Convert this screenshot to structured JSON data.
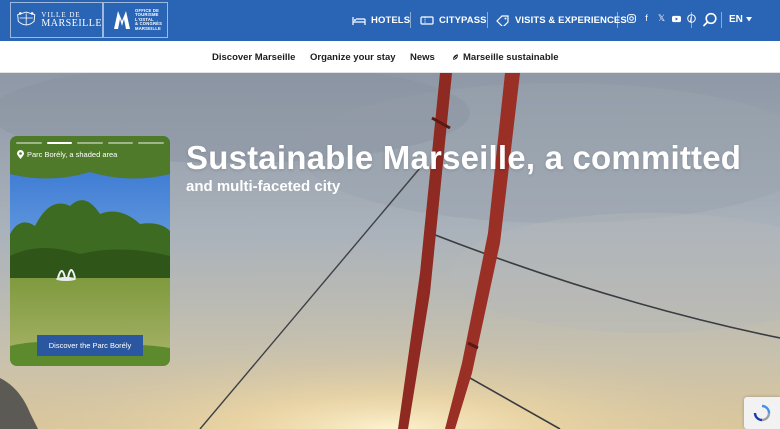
{
  "header": {
    "logo_ville_line1": "VILLE DE",
    "logo_ville_line2": "MARSEILLE",
    "logo_ot_lines": [
      "OFFICE DE",
      "TOURISME",
      "L'OSTAL",
      "& CONGRÈS",
      "MARSEILLE"
    ],
    "nav": [
      {
        "label": "HOTELS",
        "icon": "bed-icon"
      },
      {
        "label": "CITYPASS",
        "icon": "ticket-icon"
      },
      {
        "label": "VISITS & EXPERIENCES",
        "icon": "tag-icon"
      }
    ],
    "social_icons": [
      "instagram-icon",
      "facebook-icon",
      "x-icon",
      "youtube-icon",
      "pinterest-icon"
    ],
    "language": "EN",
    "colors": {
      "primary": "#2a64b4"
    }
  },
  "subnav": {
    "items": [
      {
        "label": "Discover Marseille"
      },
      {
        "label": "Organize your stay"
      },
      {
        "label": "News"
      },
      {
        "label": "Marseille sustainable",
        "icon": "leaf-icon"
      }
    ]
  },
  "hero": {
    "title": "Sustainable Marseille, a committed",
    "subtitle": "and multi-faceted city"
  },
  "story_card": {
    "location": "Parc Borély, a shaded area",
    "button_label": "Discover the Parc Borély",
    "progress_total": 5,
    "progress_active_index": 1
  }
}
